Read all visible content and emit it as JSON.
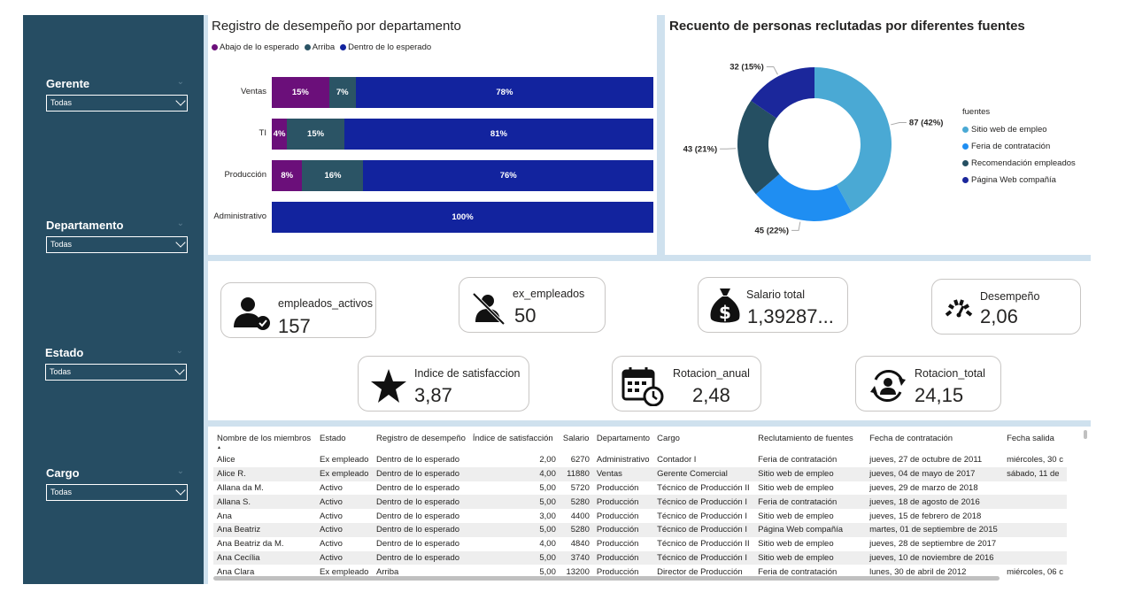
{
  "filters": [
    {
      "label": "Gerente",
      "value": "Todas"
    },
    {
      "label": "Departamento",
      "value": "Todas"
    },
    {
      "label": "Estado",
      "value": "Todas"
    },
    {
      "label": "Cargo",
      "value": "Todas"
    }
  ],
  "perf_chart": {
    "title": "Registro de desempeño por departamento",
    "legend": [
      {
        "label": "Abajo de lo esperado",
        "color": "#6b0f7a"
      },
      {
        "label": "Arriba",
        "color": "#2b5465"
      },
      {
        "label": "Dentro de lo esperado",
        "color": "#12239e"
      }
    ]
  },
  "donut_chart": {
    "title": "Recuento de personas reclutadas por diferentes fuentes",
    "legend_title": "fuentes",
    "legend": [
      {
        "label": "Sitio web de empleo",
        "color": "#4aa9d4"
      },
      {
        "label": "Feria de contratación",
        "color": "#1f8ef2"
      },
      {
        "label": "Recomendación empleados",
        "color": "#254f62"
      },
      {
        "label": "Página Web compañía",
        "color": "#1b279b"
      }
    ],
    "labels": [
      "87 (42%)",
      "45 (22%)",
      "43 (21%)",
      "32 (15%)"
    ]
  },
  "chart_data": [
    {
      "type": "bar",
      "title": "Registro de desempeño por departamento",
      "orientation": "horizontal-stacked-100",
      "categories": [
        "Ventas",
        "TI",
        "Producción",
        "Administrativo"
      ],
      "series": [
        {
          "name": "Abajo de lo esperado",
          "values": [
            15,
            4,
            8,
            0
          ],
          "labels": [
            "15%",
            "4%",
            "8%",
            ""
          ]
        },
        {
          "name": "Arriba",
          "values": [
            7,
            15,
            16,
            0
          ],
          "labels": [
            "7%",
            "15%",
            "16%",
            ""
          ]
        },
        {
          "name": "Dentro de lo esperado",
          "values": [
            78,
            81,
            76,
            100
          ],
          "labels": [
            "78%",
            "81%",
            "76%",
            "100%"
          ]
        }
      ],
      "legend_position": "top-left"
    },
    {
      "type": "pie",
      "variant": "donut",
      "title": "Recuento de personas reclutadas por diferentes fuentes",
      "categories": [
        "Sitio web de empleo",
        "Feria de contratación",
        "Recomendación empleados",
        "Página Web compañía"
      ],
      "values": [
        87,
        45,
        43,
        32
      ],
      "percent": [
        42,
        22,
        21,
        15
      ],
      "legend_position": "right"
    }
  ],
  "kpis": {
    "activos": {
      "label": "empleados_activos",
      "value": "157"
    },
    "ex": {
      "label": "ex_empleados",
      "value": "50"
    },
    "salario": {
      "label": "Salario total",
      "value": "1,39287..."
    },
    "desempeno": {
      "label": "Desempeño",
      "value": "2,06"
    },
    "satisfaccion": {
      "label": "Indice de satisfaccion",
      "value": "3,87"
    },
    "rot_anual": {
      "label": "Rotacion_anual",
      "value": "2,48"
    },
    "rot_total": {
      "label": "Rotacion_total",
      "value": "24,15"
    }
  },
  "table": {
    "headers": [
      "Nombre de los miembros",
      "Estado",
      "Registro de desempeño",
      "Índice de satisfacción",
      "Salario",
      "Departamento",
      "Cargo",
      "Reclutamiento de fuentes",
      "Fecha de contratación",
      "Fecha salida"
    ],
    "rows": [
      [
        "Alice",
        "Ex empleado",
        "Dentro de lo esperado",
        "2,00",
        "6270",
        "Administrativo",
        "Contador I",
        "Feria de contratación",
        "jueves, 27 de octubre de 2011",
        "miércoles, 30 c"
      ],
      [
        "Alice R.",
        "Ex empleado",
        "Dentro de lo esperado",
        "4,00",
        "11880",
        "Ventas",
        "Gerente Comercial",
        "Sitio web de empleo",
        "jueves, 04 de mayo de 2017",
        "sábado, 11 de"
      ],
      [
        "Allana da M.",
        "Activo",
        "Dentro de lo esperado",
        "5,00",
        "5720",
        "Producción",
        "Técnico de Producción II",
        "Sitio web de empleo",
        "jueves, 29 de marzo de 2018",
        ""
      ],
      [
        "Allana S.",
        "Activo",
        "Dentro de lo esperado",
        "5,00",
        "5280",
        "Producción",
        "Técnico de Producción I",
        "Feria de contratación",
        "jueves, 18 de agosto de 2016",
        ""
      ],
      [
        "Ana",
        "Activo",
        "Dentro de lo esperado",
        "3,00",
        "4400",
        "Producción",
        "Técnico de Producción I",
        "Sitio web de empleo",
        "jueves, 15 de febrero de 2018",
        ""
      ],
      [
        "Ana Beatriz",
        "Activo",
        "Dentro de lo esperado",
        "5,00",
        "5280",
        "Producción",
        "Técnico de Producción I",
        "Página Web compañía",
        "martes, 01 de septiembre de 2015",
        ""
      ],
      [
        "Ana Beatriz da M.",
        "Activo",
        "Dentro de lo esperado",
        "4,00",
        "4840",
        "Producción",
        "Técnico de Producción II",
        "Sitio web de empleo",
        "jueves, 28 de septiembre de 2017",
        ""
      ],
      [
        "Ana Cecília",
        "Activo",
        "Dentro de lo esperado",
        "5,00",
        "3740",
        "Producción",
        "Técnico de Producción I",
        "Sitio web de empleo",
        "jueves, 10 de noviembre de 2016",
        ""
      ],
      [
        "Ana Clara",
        "Ex empleado",
        "Arriba",
        "5,00",
        "13200",
        "Producción",
        "Director de Producción",
        "Feria de contratación",
        "lunes, 30 de abril de 2012",
        "miércoles, 06 c"
      ]
    ]
  }
}
